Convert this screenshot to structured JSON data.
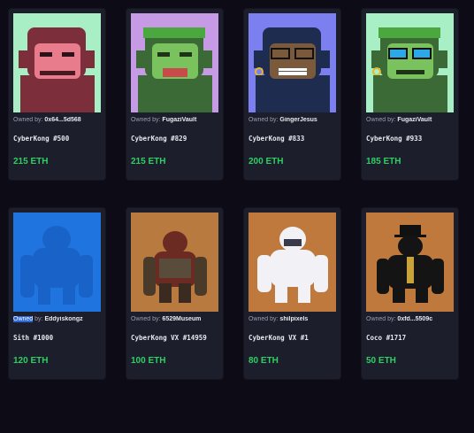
{
  "owned_prefix": "Owned by:",
  "cards": [
    {
      "owner_prefix": "Owned by:",
      "owner": "0x64...5d568",
      "name": "CyberKong #500",
      "price": "215 ETH",
      "bg": "#a8efc6",
      "fur": "#7c2f3a",
      "face": "#e87c8c"
    },
    {
      "owner_prefix": "Owned by:",
      "owner": "FugaziVault",
      "name": "CyberKong #829",
      "price": "215 ETH",
      "bg": "#c79ae6",
      "fur": "#3b6a36",
      "face": "#79c25e"
    },
    {
      "owner_prefix": "Owned by:",
      "owner": "GingerJesus",
      "name": "CyberKong #833",
      "price": "200 ETH",
      "bg": "#7b7ff0",
      "fur": "#1e2c4f",
      "face": "#7a5a3a"
    },
    {
      "owner_prefix": "Owned by:",
      "owner": "FugaziVault",
      "name": "CyberKong #933",
      "price": "185 ETH",
      "bg": "#a8efc6",
      "fur": "#3b6a36",
      "face": "#79c25e"
    },
    {
      "owner_prefix": "Owned",
      "owner_suffix": " by:",
      "owner": "Eddyiskongz",
      "name": "Sith #1000",
      "price": "120 ETH",
      "bg": "#1f74e0",
      "fur": "#1862c8"
    },
    {
      "owner_prefix": "Owned by:",
      "owner": "6529Museum",
      "name": "CyberKong VX #14959",
      "price": "100 ETH",
      "bg": "#b87a3e",
      "fur": "#6b2b22"
    },
    {
      "owner_prefix": "Owned by:",
      "owner": "shilpixels",
      "name": "CyberKong VX #1",
      "price": "80 ETH",
      "bg": "#c0793c",
      "fur": "#f2f2f6"
    },
    {
      "owner_prefix": "Owned by:",
      "owner": "0xfd...5509c",
      "name": "Coco #1717",
      "price": "50 ETH",
      "bg": "#c0793c",
      "fur": "#141414"
    }
  ]
}
